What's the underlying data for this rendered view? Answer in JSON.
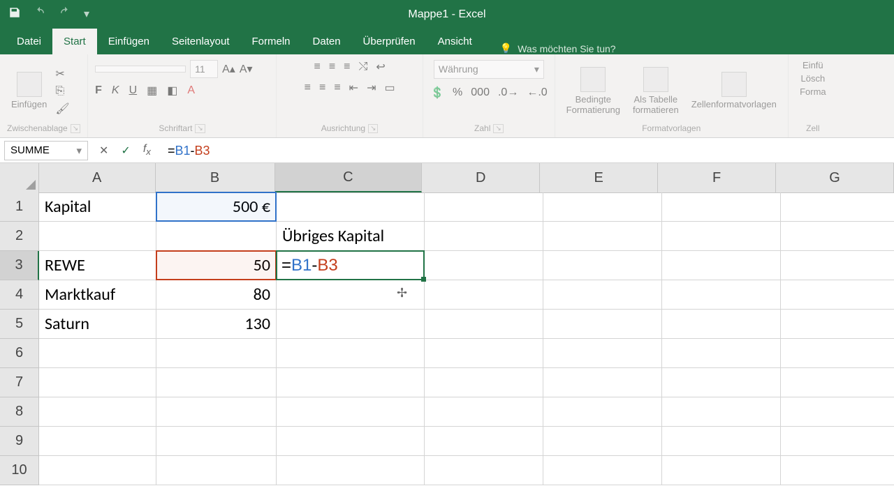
{
  "app": {
    "title": "Mappe1 - Excel"
  },
  "tabs": {
    "file": "Datei",
    "home": "Start",
    "insert": "Einfügen",
    "layout": "Seitenlayout",
    "formulas": "Formeln",
    "data": "Daten",
    "review": "Überprüfen",
    "view": "Ansicht",
    "tellme": "Was möchten Sie tun?"
  },
  "ribbon": {
    "clipboard": {
      "label": "Zwischenablage",
      "paste": "Einfügen"
    },
    "font": {
      "label": "Schriftart",
      "name": "",
      "size": "11",
      "b": "F",
      "i": "K",
      "u": "U"
    },
    "align": {
      "label": "Ausrichtung"
    },
    "number": {
      "label": "Zahl",
      "format": "Währung"
    },
    "styles": {
      "label": "Formatvorlagen",
      "cond": "Bedingte\nFormatierung",
      "table": "Als Tabelle\nformatieren",
      "cellstyles": "Zellenformatvorlagen"
    },
    "cells": {
      "label": "Zell",
      "insert": "Einfü",
      "delete": "Lösch",
      "format": "Forma"
    }
  },
  "namebox": "SUMME",
  "formula": {
    "eq": "=",
    "ref1": "B1",
    "op": "-",
    "ref2": "B3"
  },
  "columns": [
    "A",
    "B",
    "C",
    "D",
    "E",
    "F",
    "G"
  ],
  "rows": [
    "1",
    "2",
    "3",
    "4",
    "5",
    "6",
    "7",
    "8",
    "9",
    "10"
  ],
  "data": {
    "A1": "Kapital",
    "B1": "500 €",
    "C2": "Übriges Kapital",
    "A3": "REWE",
    "B3": "50",
    "C3": "=B1-B3",
    "A4": "Marktkauf",
    "B4": "80",
    "A5": "Saturn",
    "B5": "130"
  },
  "active_cell": "C3",
  "refs": {
    "blue": "B1",
    "red": "B3"
  }
}
